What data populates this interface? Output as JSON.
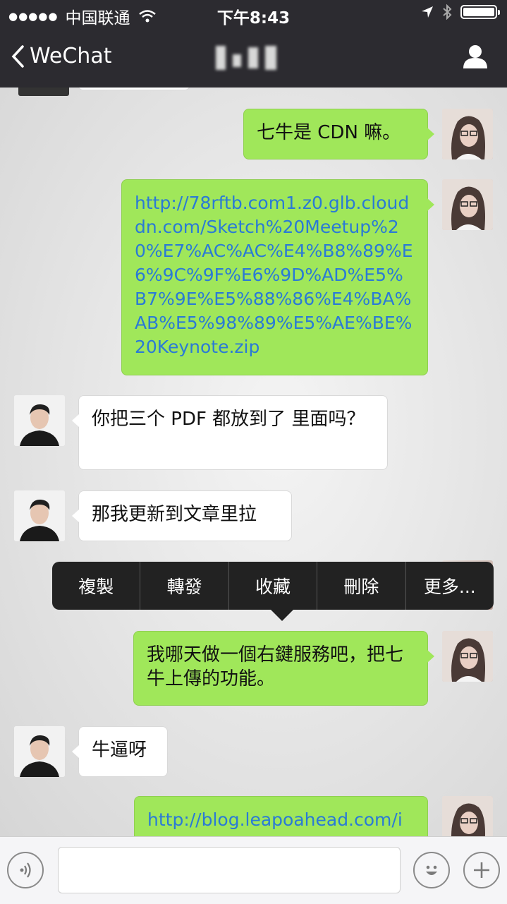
{
  "status_bar": {
    "carrier": "中国联通",
    "time": "下午8:43"
  },
  "nav": {
    "back_label": "WeChat"
  },
  "messages": [
    {
      "side": "right",
      "text": "七牛是 CDN 嘛。"
    },
    {
      "side": "right",
      "text": "http://78rftb.com1.z0.glb.clouddn.com/Sketch%20Meetup%20%E7%AC%AC%E4%B8%89%E6%9C%9F%E6%9D%AD%E5%B7%9E%E5%88%86%E4%BA%AB%E5%98%89%E5%AE%BE%20Keynote.zip",
      "is_link": true
    },
    {
      "side": "left",
      "text": "你把三个 PDF 都放到了 里面吗？"
    },
    {
      "side": "left",
      "text": "那我更新到文章里拉"
    },
    {
      "side": "right",
      "text": "我哪天做一個右鍵服務吧，把七牛上傳的功能。"
    },
    {
      "side": "left",
      "text": "牛逼呀"
    },
    {
      "side": "right",
      "text": "http://blog.leapoahead.com/i",
      "is_link": true
    }
  ],
  "context_menu": [
    "複製",
    "轉發",
    "收藏",
    "刪除",
    "更多..."
  ],
  "colors": {
    "header_bg": "#2c2b30",
    "right_bubble": "#a0e75a",
    "left_bubble": "#ffffff",
    "link": "#2a7ad6",
    "menu_bg": "#222222"
  },
  "icons": [
    "back-chevron-icon",
    "person-icon",
    "voice-icon",
    "emoji-icon",
    "add-icon",
    "location-arrow-icon",
    "bluetooth-icon",
    "wifi-icon",
    "battery-icon"
  ]
}
